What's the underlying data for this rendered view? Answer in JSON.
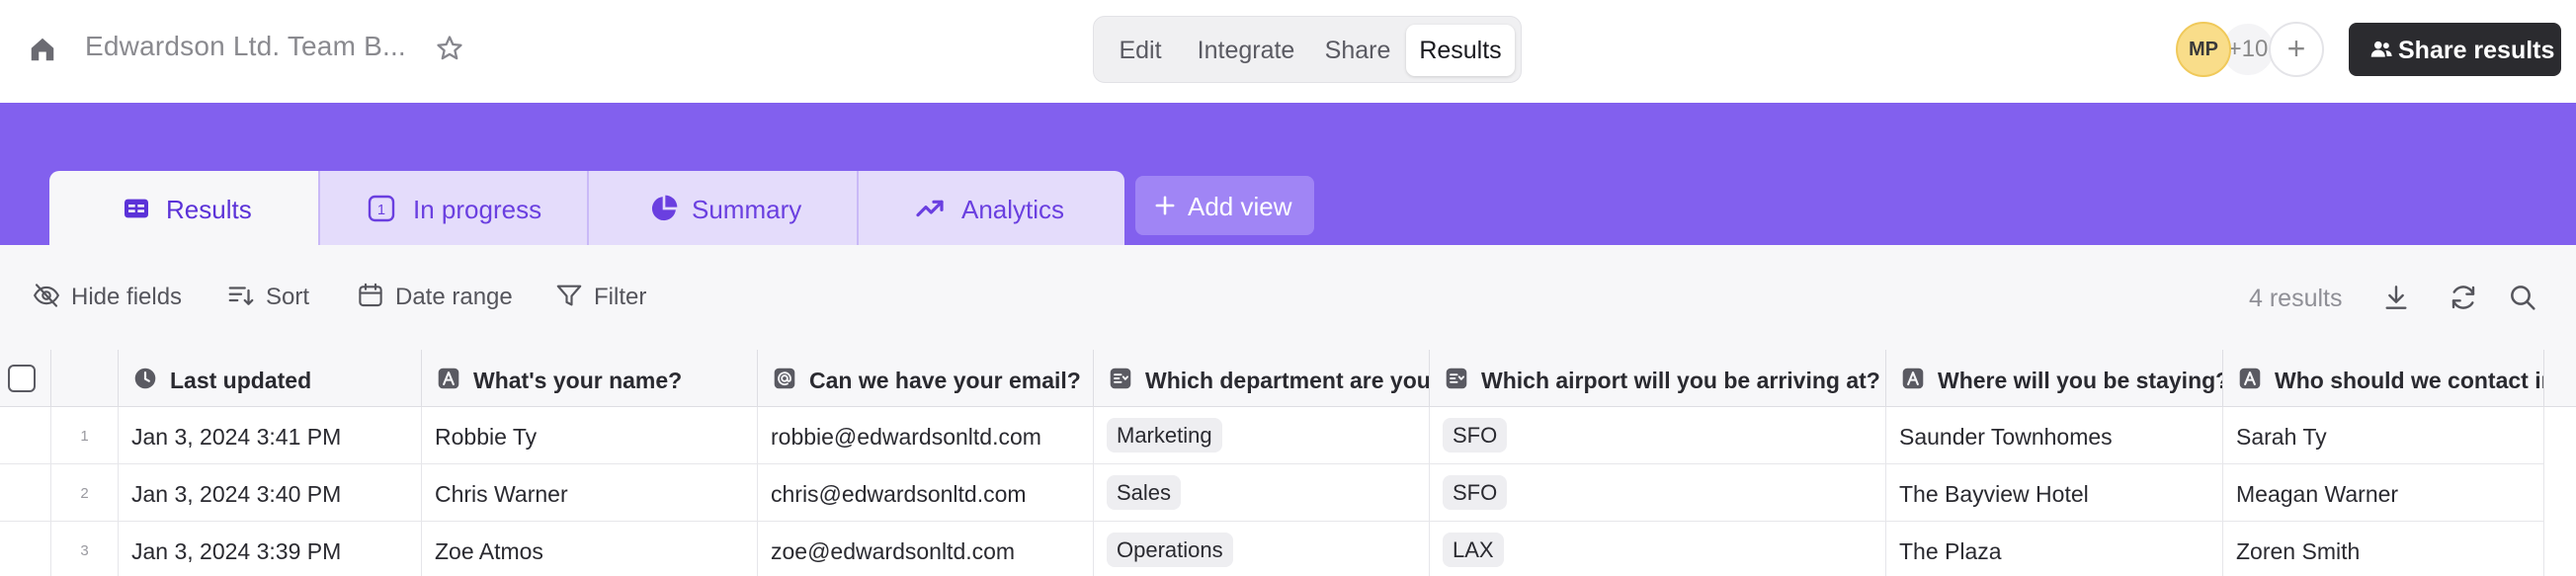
{
  "header": {
    "form_title": "Edwardson Ltd. Team B...",
    "mode_tabs": [
      "Edit",
      "Integrate",
      "Share",
      "Results"
    ],
    "active_mode": "Results",
    "avatar_initials": "MP",
    "avatar_overflow": "+10",
    "add_collaborator": "+",
    "share_results_label": "Share results"
  },
  "views": {
    "tabs": [
      {
        "label": "Results",
        "icon": "table-icon"
      },
      {
        "label": "In progress",
        "icon": "number-badge-icon",
        "badge": "1"
      },
      {
        "label": "Summary",
        "icon": "pie-chart-icon"
      },
      {
        "label": "Analytics",
        "icon": "trending-up-icon"
      }
    ],
    "active": "Results",
    "add_view_label": "Add view"
  },
  "toolbar": {
    "hide_fields": "Hide fields",
    "sort": "Sort",
    "date_range": "Date range",
    "filter": "Filter",
    "results_count": "4 results"
  },
  "table": {
    "columns": [
      {
        "label": "Last updated",
        "icon": "clock-icon"
      },
      {
        "label": "What's your name?",
        "icon": "text-field-icon"
      },
      {
        "label": "Can we have your email?",
        "icon": "at-sign-icon"
      },
      {
        "label": "Which department are you in?",
        "icon": "dropdown-field-icon"
      },
      {
        "label": "Which airport will you be arriving at?",
        "icon": "dropdown-field-icon"
      },
      {
        "label": "Where will you be staying?",
        "icon": "text-field-icon"
      },
      {
        "label": "Who should we contact in case of emergency?",
        "icon": "text-field-icon"
      }
    ],
    "rows": [
      {
        "num": "1",
        "updated": "Jan 3, 2024 3:41 PM",
        "name": "Robbie Ty",
        "email": "robbie@edwardsonltd.com",
        "department": "Marketing",
        "airport": "SFO",
        "staying": "Saunder Townhomes",
        "contact": "Sarah Ty"
      },
      {
        "num": "2",
        "updated": "Jan 3, 2024 3:40 PM",
        "name": "Chris Warner",
        "email": "chris@edwardsonltd.com",
        "department": "Sales",
        "airport": "SFO",
        "staying": "The Bayview Hotel",
        "contact": "Meagan Warner"
      },
      {
        "num": "3",
        "updated": "Jan 3, 2024 3:39 PM",
        "name": "Zoe Atmos",
        "email": "zoe@edwardsonltd.com",
        "department": "Operations",
        "airport": "LAX",
        "staying": "The Plaza",
        "contact": "Zoren Smith"
      }
    ]
  },
  "colors": {
    "accent": "#8260ee",
    "tab_text": "#6a3fe0",
    "button_dark": "#2b2b2f"
  }
}
